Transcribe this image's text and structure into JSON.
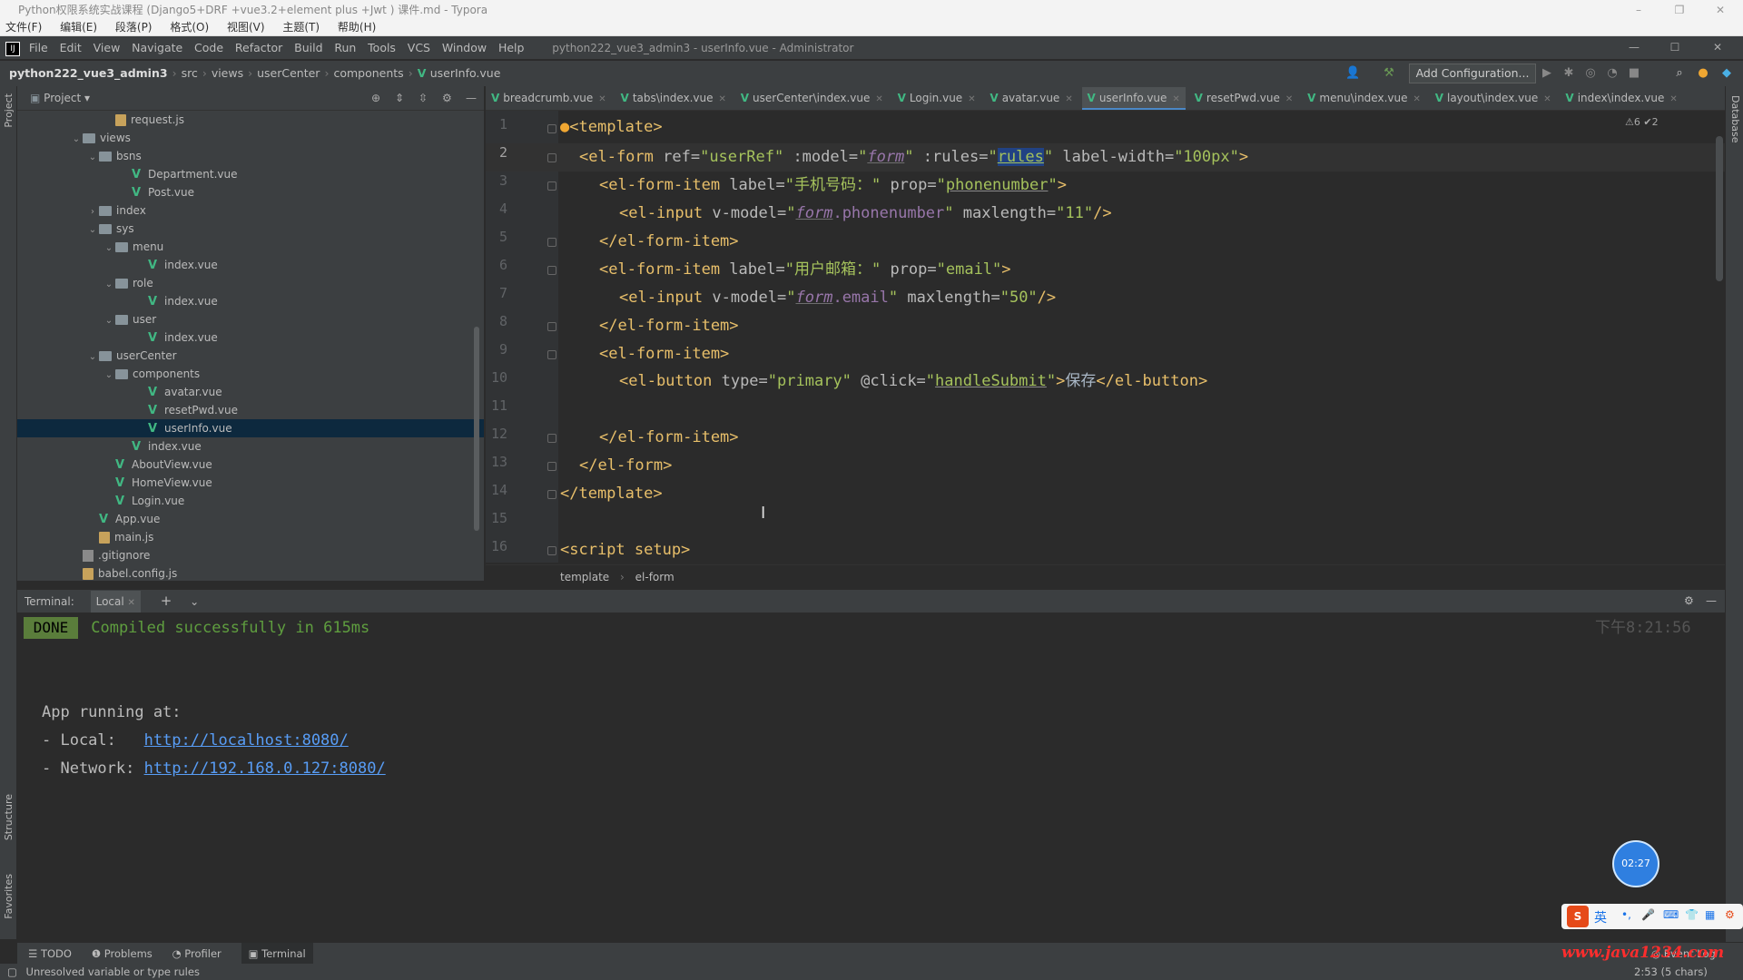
{
  "outer_window": {
    "title": "Python权限系统实战课程 (Django5+DRF +vue3.2+element plus +Jwt ) 课件.md - Typora",
    "menu": [
      "文件(F)",
      "编辑(E)",
      "段落(P)",
      "格式(O)",
      "视图(V)",
      "主题(T)",
      "帮助(H)"
    ]
  },
  "ide": {
    "menu": [
      "File",
      "Edit",
      "View",
      "Navigate",
      "Code",
      "Refactor",
      "Build",
      "Run",
      "Tools",
      "VCS",
      "Window",
      "Help"
    ],
    "window_title": "python222_vue3_admin3 - userInfo.vue - Administrator",
    "breadcrumbs": [
      "python222_vue3_admin3",
      "src",
      "views",
      "userCenter",
      "components",
      "userInfo.vue"
    ],
    "add_configuration": "Add Configuration..."
  },
  "project_panel": {
    "title": "Project",
    "tree": [
      {
        "label": "request.js",
        "icon": "js",
        "depth": 4
      },
      {
        "label": "views",
        "icon": "folder",
        "depth": 2,
        "expanded": true
      },
      {
        "label": "bsns",
        "icon": "folder",
        "depth": 3,
        "expanded": true
      },
      {
        "label": "Department.vue",
        "icon": "vue",
        "depth": 5
      },
      {
        "label": "Post.vue",
        "icon": "vue",
        "depth": 5
      },
      {
        "label": "index",
        "icon": "folder",
        "depth": 3,
        "expanded": false
      },
      {
        "label": "sys",
        "icon": "folder",
        "depth": 3,
        "expanded": true
      },
      {
        "label": "menu",
        "icon": "folder",
        "depth": 4,
        "expanded": true
      },
      {
        "label": "index.vue",
        "icon": "vue",
        "depth": 6
      },
      {
        "label": "role",
        "icon": "folder",
        "depth": 4,
        "expanded": true
      },
      {
        "label": "index.vue",
        "icon": "vue",
        "depth": 6
      },
      {
        "label": "user",
        "icon": "folder",
        "depth": 4,
        "expanded": true
      },
      {
        "label": "index.vue",
        "icon": "vue",
        "depth": 6
      },
      {
        "label": "userCenter",
        "icon": "folder",
        "depth": 3,
        "expanded": true
      },
      {
        "label": "components",
        "icon": "folder",
        "depth": 4,
        "expanded": true
      },
      {
        "label": "avatar.vue",
        "icon": "vue",
        "depth": 6
      },
      {
        "label": "resetPwd.vue",
        "icon": "vue",
        "depth": 6
      },
      {
        "label": "userInfo.vue",
        "icon": "vue",
        "depth": 6,
        "selected": true
      },
      {
        "label": "index.vue",
        "icon": "vue",
        "depth": 5
      },
      {
        "label": "AboutView.vue",
        "icon": "vue",
        "depth": 4
      },
      {
        "label": "HomeView.vue",
        "icon": "vue",
        "depth": 4
      },
      {
        "label": "Login.vue",
        "icon": "vue",
        "depth": 4
      },
      {
        "label": "App.vue",
        "icon": "vue",
        "depth": 3
      },
      {
        "label": "main.js",
        "icon": "js",
        "depth": 3
      },
      {
        "label": ".gitignore",
        "icon": "file",
        "depth": 2
      },
      {
        "label": "babel.config.js",
        "icon": "js",
        "depth": 2
      }
    ]
  },
  "editor": {
    "tabs": [
      {
        "label": "breadcrumb.vue",
        "active": false
      },
      {
        "label": "tabs\\index.vue",
        "active": false
      },
      {
        "label": "userCenter\\index.vue",
        "active": false
      },
      {
        "label": "Login.vue",
        "active": false
      },
      {
        "label": "avatar.vue",
        "active": false
      },
      {
        "label": "userInfo.vue",
        "active": true
      },
      {
        "label": "resetPwd.vue",
        "active": false
      },
      {
        "label": "menu\\index.vue",
        "active": false
      },
      {
        "label": "layout\\index.vue",
        "active": false
      },
      {
        "label": "index\\index.vue",
        "active": false
      }
    ],
    "line_numbers": [
      "1",
      "2",
      "3",
      "4",
      "5",
      "6",
      "7",
      "8",
      "9",
      "10",
      "11",
      "12",
      "13",
      "14",
      "15",
      "16"
    ],
    "current_line": "2",
    "inspection_status": "⚠6 ✔2",
    "structure_breadcrumb": [
      "template",
      "el-form"
    ],
    "code": {
      "l1": "<template>",
      "l2_open": "<el-form",
      "l2_ref": " ref=",
      "l2_ref_val": "\"userRef\"",
      "l2_model": " :model=",
      "l2_q1": "\"",
      "l2_form": "form",
      "l2_q2": "\"",
      "l2_rules": " :rules=",
      "l2_q3": "\"",
      "l2_rules_val": "rules",
      "l2_q4": "\"",
      "l2_lw": " label-width=",
      "l2_lw_val": "\"100px\"",
      "l2_close": ">",
      "l3_open": "<el-form-item",
      "l3_label": " label=",
      "l3_label_val": "\"手机号码：\"",
      "l3_prop": " prop=",
      "l3_q1": "\"",
      "l3_prop_val": "phonenumber",
      "l3_q2": "\"",
      "l3_close": ">",
      "l4_open": "<el-input",
      "l4_vm": " v-model=",
      "l4_q1": "\"",
      "l4_form": "form",
      "l4_field": ".phonenumber",
      "l4_q2": "\"",
      "l4_ml": " maxlength=",
      "l4_ml_val": "\"11\"",
      "l4_close": "/>",
      "l5": "</el-form-item>",
      "l6_open": "<el-form-item",
      "l6_label": " label=",
      "l6_label_val": "\"用户邮箱：\"",
      "l6_prop": " prop=",
      "l6_prop_val": "\"email\"",
      "l6_close": ">",
      "l7_open": "<el-input",
      "l7_vm": " v-model=",
      "l7_q1": "\"",
      "l7_form": "form",
      "l7_field": ".email",
      "l7_q2": "\"",
      "l7_ml": " maxlength=",
      "l7_ml_val": "\"50\"",
      "l7_close": "/>",
      "l8": "</el-form-item>",
      "l9": "<el-form-item>",
      "l10_open": "<el-button",
      "l10_type": " type=",
      "l10_type_val": "\"primary\"",
      "l10_click": " @click=",
      "l10_q1": "\"",
      "l10_handler": "handleSubmit",
      "l10_q2": "\"",
      "l10_gt": ">",
      "l10_text": "保存",
      "l10_close": "</el-button>",
      "l12": "</el-form-item>",
      "l13": "</el-form>",
      "l14": "</template>",
      "l16": "<script setup>"
    }
  },
  "terminal": {
    "title": "Terminal:",
    "tab": "Local",
    "done": "DONE",
    "compiled": " Compiled successfully in 615ms",
    "time": "下午8:21:56",
    "app_running": "App running at:",
    "local_label": "- Local:   ",
    "local_url": "http://localhost:8080/",
    "network_label": "- Network: ",
    "network_url": "http://192.168.0.127:8080/"
  },
  "bottom_tools": [
    "TODO",
    "Problems",
    "Profiler",
    "Terminal"
  ],
  "event_log": "Event Log",
  "status": {
    "message": "Unresolved variable or type rules",
    "position": "2:53 (5 chars)"
  },
  "side_labels": {
    "project": "Project",
    "structure": "Structure",
    "favorites": "Favorites",
    "database": "Database"
  },
  "overlay": {
    "timer": "02:27",
    "ime": "英",
    "watermark": "www.java1234.com"
  }
}
